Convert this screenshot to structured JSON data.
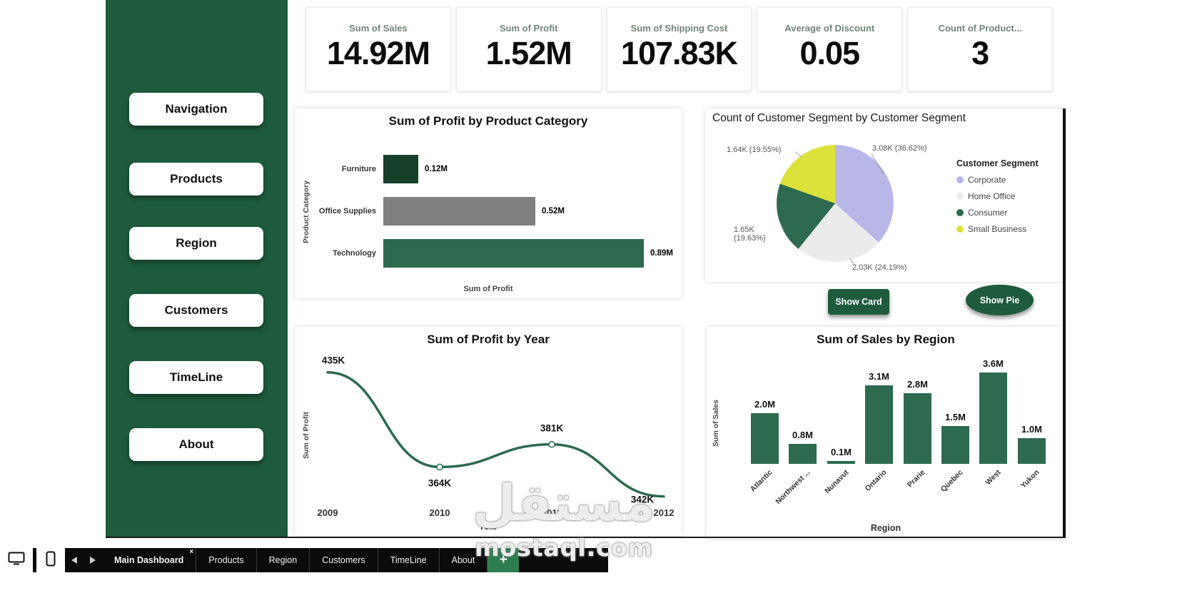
{
  "colors": {
    "sidebar_green": "#1e5b3c",
    "accent_green": "#2d6a4f",
    "dark_green": "#16402a",
    "gray_bar": "#7f7f7f",
    "tabbar_black": "#0b0b0b",
    "add_tab_green": "#2e7d51"
  },
  "sidebar": {
    "items": [
      "Navigation",
      "Products",
      "Region",
      "Customers",
      "TimeLine",
      "About"
    ]
  },
  "kpi_cards": [
    {
      "label": "Sum of Sales",
      "value": "14.92M"
    },
    {
      "label": "Sum of Profit",
      "value": "1.52M"
    },
    {
      "label": "Sum of Shipping Cost",
      "value": "107.83K"
    },
    {
      "label": "Average of Discount",
      "value": "0.05"
    },
    {
      "label": "Count of Product...",
      "value": "3"
    }
  ],
  "buttons": {
    "show_card": "Show Card",
    "show_pie": "Show Pie"
  },
  "chart_data": [
    {
      "type": "bar",
      "orientation": "horizontal",
      "title": "Sum of Profit by Product Category",
      "categories": [
        "Furniture",
        "Office Supplies",
        "Technology"
      ],
      "values": [
        0.12,
        0.52,
        0.89
      ],
      "value_labels": [
        "0.12M",
        "0.52M",
        "0.89M"
      ],
      "colors": [
        "#16402a",
        "#7f7f7f",
        "#2d6a4f"
      ],
      "xlabel": "Sum of Profit",
      "ylabel": "Product Category",
      "xlim": [
        0,
        1.0
      ],
      "grid": false
    },
    {
      "type": "pie",
      "title": "Count of Customer Segment by Customer Segment",
      "legend_title": "Customer Segment",
      "legend_position": "right",
      "segments": [
        {
          "name": "Corporate",
          "value": "3.08K",
          "pct": 36.62,
          "color": "#b9b7e8",
          "label": "3.08K (36.62%)"
        },
        {
          "name": "Home Office",
          "value": "2.03K",
          "pct": 24.19,
          "color": "#ebebeb",
          "label": "2.03K (24.19%)"
        },
        {
          "name": "Consumer",
          "value": "1.65K",
          "pct": 19.63,
          "color": "#2d6a4f",
          "label": "1.65K (19.63%)"
        },
        {
          "name": "Small Business",
          "value": "1.64K",
          "pct": 19.55,
          "color": "#dce23a",
          "label": "1.64K (19.55%)"
        }
      ]
    },
    {
      "type": "line",
      "title": "Sum of Profit by Year",
      "x": [
        "2009",
        "2010",
        "2011",
        "2012"
      ],
      "values": [
        435,
        364,
        381,
        342
      ],
      "value_labels": [
        "435K",
        "364K",
        "381K",
        "342K"
      ],
      "unit": "K",
      "xlabel": "Year",
      "ylabel": "Sum of Profit",
      "ylim": [
        330,
        445
      ],
      "color": "#2d6a4f",
      "grid": false
    },
    {
      "type": "bar",
      "orientation": "vertical",
      "title": "Sum of Sales by Region",
      "categories": [
        "Atlantic",
        "Northwest ...",
        "Nunavut",
        "Ontario",
        "Prarie",
        "Quebec",
        "West",
        "Yukon"
      ],
      "values": [
        2.0,
        0.8,
        0.1,
        3.1,
        2.8,
        1.5,
        3.6,
        1.0
      ],
      "value_labels": [
        "2.0M",
        "0.8M",
        "0.1M",
        "3.1M",
        "2.8M",
        "1.5M",
        "3.6M",
        "1.0M"
      ],
      "xlabel": "Region",
      "ylabel": "Sum of Sales",
      "ylim": [
        0,
        3.8
      ],
      "color": "#2d6a4f",
      "grid": false
    }
  ],
  "tab_bar": {
    "tabs": [
      "Main Dashboard",
      "Products",
      "Region",
      "Customers",
      "TimeLine",
      "About"
    ],
    "active": "Main Dashboard",
    "close_glyph": "×",
    "add_label": "+"
  },
  "watermark": {
    "line1": "مستقل",
    "line2": "mostaql.com"
  }
}
